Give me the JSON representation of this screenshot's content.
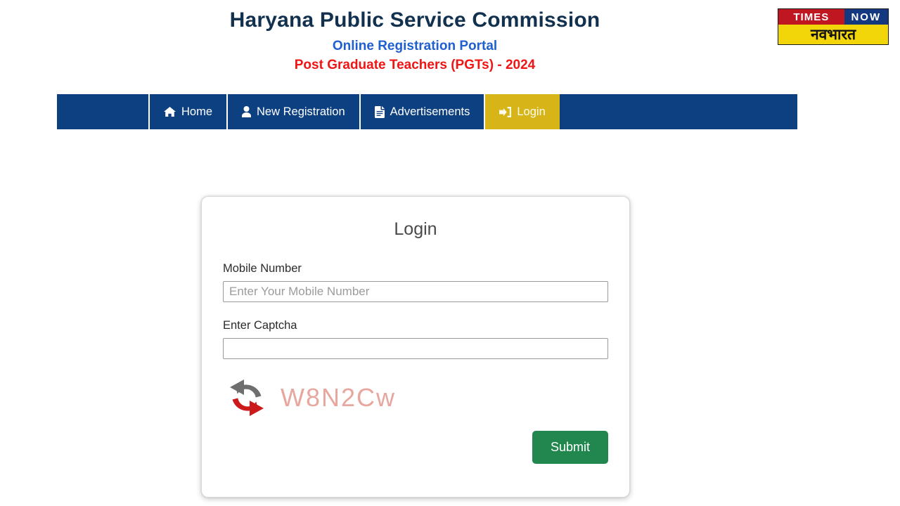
{
  "header": {
    "title_main": "Haryana Public Service Commission",
    "title_sub": "Online Registration Portal",
    "title_third": "Post Graduate Teachers (PGTs) - 2024",
    "brand": {
      "times": "TIMES",
      "now": "NOW",
      "hindi": "नवभारत"
    },
    "colors": {
      "title_main": "#11314f",
      "title_sub": "#1f5fd0",
      "title_third": "#f01414",
      "brand_red": "#c01622",
      "brand_blue": "#14387f",
      "brand_yellow": "#f2d60a"
    }
  },
  "nav": {
    "background": "#0d4080",
    "active_background": "#d7b518",
    "items": [
      {
        "label": "Home",
        "icon": "home-icon",
        "active": false
      },
      {
        "label": "New Registration",
        "icon": "user-icon",
        "active": false
      },
      {
        "label": "Advertisements",
        "icon": "document-icon",
        "active": false
      },
      {
        "label": "Login",
        "icon": "sign-in-icon",
        "active": true
      }
    ]
  },
  "login_card": {
    "title": "Login",
    "mobile": {
      "label": "Mobile Number",
      "placeholder": "Enter Your Mobile Number",
      "value": ""
    },
    "captcha": {
      "label": "Enter Captcha",
      "placeholder": "",
      "value": "",
      "code": "W8N2Cw",
      "code_color": "#e8a79e",
      "refresh_icon": "refresh-icon"
    },
    "submit": {
      "label": "Submit",
      "color": "#21874e"
    }
  }
}
